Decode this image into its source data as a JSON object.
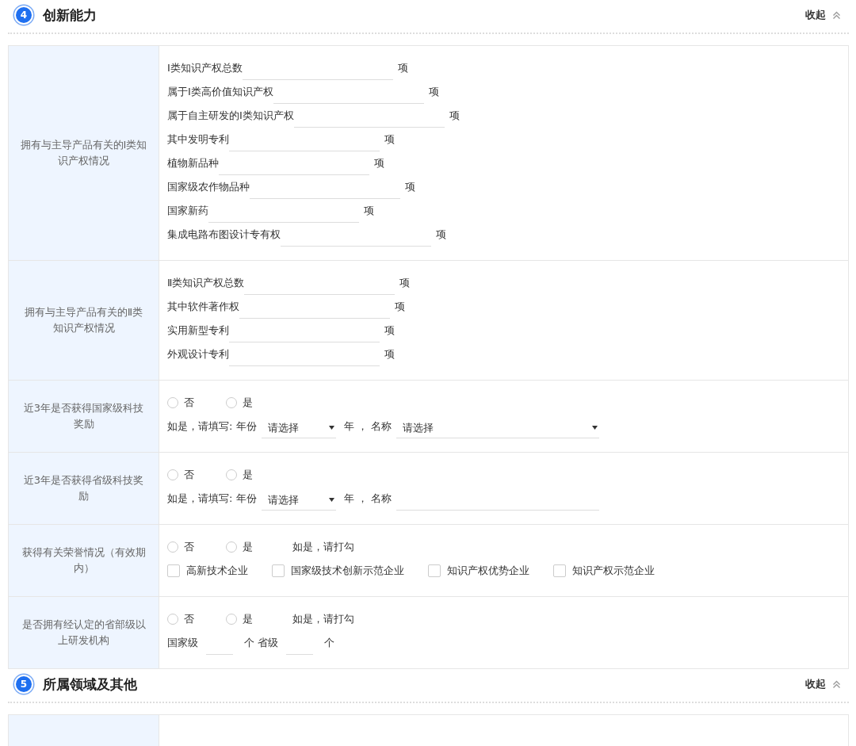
{
  "sections": [
    {
      "number": "4",
      "title": "创新能力",
      "collapse_label": "收起",
      "rows": [
        {
          "label": "拥有与主导产品有关的Ⅰ类知识产权情况",
          "lines": [
            [
              {
                "kind": "field",
                "label": "Ⅰ类知识产权总数",
                "unit": "项"
              }
            ],
            [
              {
                "kind": "field",
                "label": "属于Ⅰ类高价值知识产权",
                "unit": "项"
              }
            ],
            [
              {
                "kind": "field",
                "label": "属于自主研发的Ⅰ类知识产权",
                "unit": "项"
              }
            ],
            [
              {
                "kind": "field",
                "label": "其中发明专利",
                "unit": "项"
              }
            ],
            [
              {
                "kind": "field",
                "label": "植物新品种",
                "unit": "项"
              }
            ],
            [
              {
                "kind": "field",
                "label": "国家级农作物品种",
                "unit": "项"
              }
            ],
            [
              {
                "kind": "field",
                "label": "国家新药",
                "unit": "项"
              }
            ],
            [
              {
                "kind": "field",
                "label": "集成电路布图设计专有权",
                "unit": "项"
              }
            ]
          ]
        },
        {
          "label": "拥有与主导产品有关的Ⅱ类知识产权情况",
          "lines": [
            [
              {
                "kind": "field",
                "label": "Ⅱ类知识产权总数",
                "unit": "项"
              }
            ],
            [
              {
                "kind": "field",
                "label": "其中软件著作权",
                "unit": "项"
              }
            ],
            [
              {
                "kind": "field",
                "label": "实用新型专利",
                "unit": "项"
              }
            ],
            [
              {
                "kind": "field",
                "label": "外观设计专利",
                "unit": "项"
              }
            ]
          ]
        },
        {
          "label": "近3年是否获得国家级科技奖励",
          "lines": [
            [
              {
                "kind": "radio",
                "label": "否",
                "selected": false
              },
              {
                "kind": "radio",
                "label": "是",
                "selected": false
              }
            ],
            [
              {
                "kind": "text",
                "text": "如是，请填写: 年份"
              },
              {
                "kind": "select",
                "value": "请选择"
              },
              {
                "kind": "text",
                "text": "年 ， 名称"
              },
              {
                "kind": "wide-select",
                "value": "请选择"
              }
            ]
          ]
        },
        {
          "label": "近3年是否获得省级科技奖励",
          "lines": [
            [
              {
                "kind": "radio",
                "label": "否",
                "selected": false
              },
              {
                "kind": "radio",
                "label": "是",
                "selected": false
              }
            ],
            [
              {
                "kind": "text",
                "text": "如是，请填写: 年份"
              },
              {
                "kind": "select",
                "value": "请选择"
              },
              {
                "kind": "text",
                "text": "年 ， 名称"
              },
              {
                "kind": "input"
              }
            ]
          ]
        },
        {
          "label": "获得有关荣誉情况（有效期内）",
          "lines": [
            [
              {
                "kind": "radio",
                "label": "否",
                "selected": false
              },
              {
                "kind": "radio",
                "label": "是",
                "selected": false
              },
              {
                "kind": "text",
                "text": "如是，请打勾"
              }
            ],
            [
              {
                "kind": "checkbox",
                "label": "高新技术企业",
                "checked": false
              },
              {
                "kind": "checkbox",
                "label": "国家级技术创新示范企业",
                "checked": false
              },
              {
                "kind": "checkbox",
                "label": "知识产权优势企业",
                "checked": false
              },
              {
                "kind": "checkbox",
                "label": "知识产权示范企业",
                "checked": false
              }
            ]
          ]
        },
        {
          "label": "是否拥有经认定的省部级以上研发机构",
          "lines": [
            [
              {
                "kind": "radio",
                "label": "否",
                "selected": false
              },
              {
                "kind": "radio",
                "label": "是",
                "selected": false
              },
              {
                "kind": "text",
                "text": "如是，请打勾"
              }
            ],
            [
              {
                "kind": "text",
                "text": "国家级"
              },
              {
                "kind": "blank"
              },
              {
                "kind": "text",
                "text": "个 省级"
              },
              {
                "kind": "blank"
              },
              {
                "kind": "text",
                "text": "个"
              }
            ]
          ]
        }
      ]
    },
    {
      "number": "5",
      "title": "所属领域及其他",
      "collapse_label": "收起"
    }
  ]
}
